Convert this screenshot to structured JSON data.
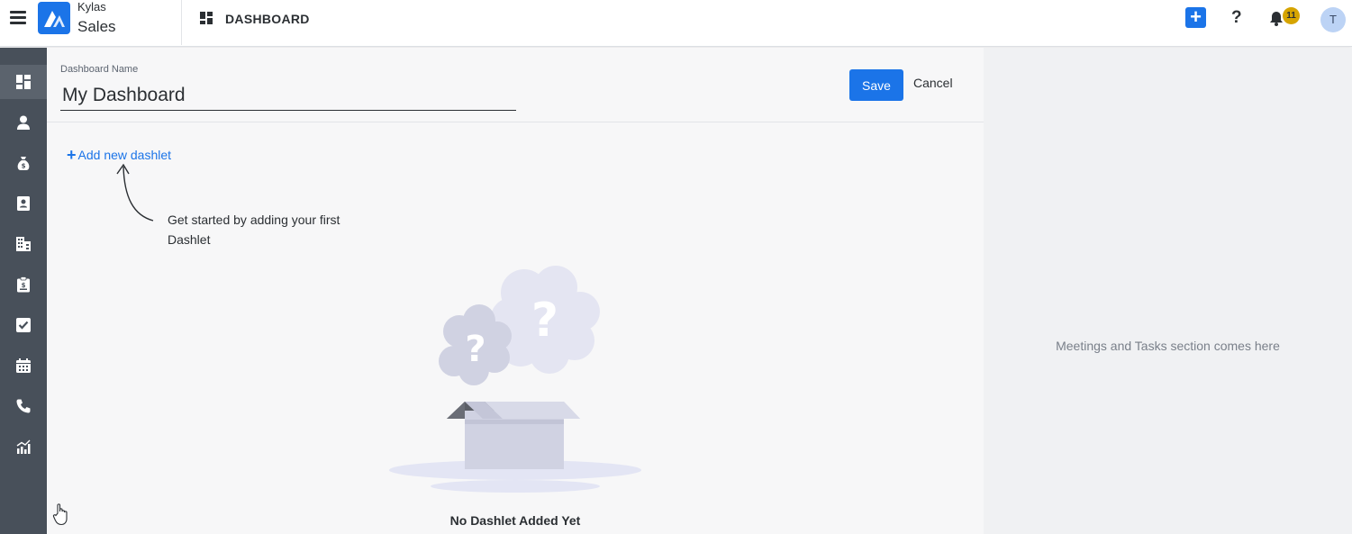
{
  "app": {
    "brand_top": "Kylas",
    "brand_bottom": "Sales",
    "accent": "#1b74e8"
  },
  "header": {
    "breadcrumb": "DASHBOARD",
    "help_label": "?",
    "add_label": "+",
    "notification_count": "11",
    "avatar_initial": "T"
  },
  "sidebar": {
    "items": [
      {
        "icon": "dashboard-icon",
        "active": true
      },
      {
        "icon": "user-icon"
      },
      {
        "icon": "money-bag-icon"
      },
      {
        "icon": "contact-card-icon"
      },
      {
        "icon": "building-icon"
      },
      {
        "icon": "clipboard-icon"
      },
      {
        "icon": "checkbox-icon"
      },
      {
        "icon": "calendar-icon"
      },
      {
        "icon": "phone-icon"
      },
      {
        "icon": "report-chart-icon"
      }
    ]
  },
  "editor": {
    "name_label": "Dashboard Name",
    "name_value": "My Dashboard",
    "save_label": "Save",
    "cancel_label": "Cancel",
    "add_dashlet_label": "Add new dashlet",
    "hint_text": "Get started by adding your first Dashlet",
    "empty_text": "No Dashlet Added Yet"
  },
  "right_panel": {
    "placeholder": "Meetings and Tasks section comes here"
  }
}
